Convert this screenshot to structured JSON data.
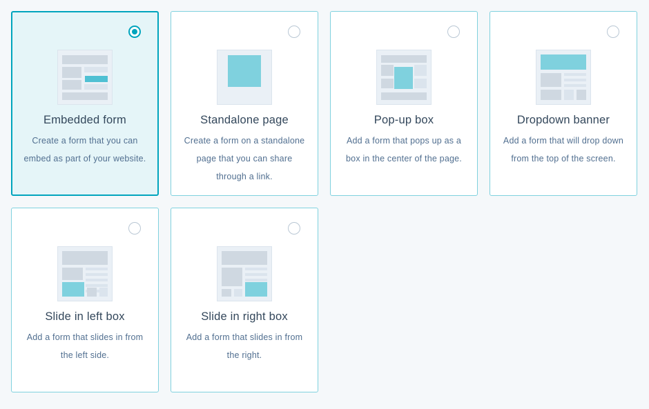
{
  "colors": {
    "accent": "#00a4bd",
    "illustration_highlight": "#7fd1de",
    "illustration_frame": "#eaf0f6",
    "selected_background": "#e5f5f8"
  },
  "selected_option": "embedded",
  "options": [
    {
      "id": "embedded",
      "title": "Embedded form",
      "description": "Create a form that you can embed as part of your website.",
      "selected": true,
      "icon": "embedded-form-icon"
    },
    {
      "id": "standalone",
      "title": "Standalone page",
      "description": "Create a form on a standalone page that you can share through a link.",
      "selected": false,
      "icon": "standalone-page-icon"
    },
    {
      "id": "popup",
      "title": "Pop-up box",
      "description": "Add a form that pops up as a box in the center of the page.",
      "selected": false,
      "icon": "popup-box-icon"
    },
    {
      "id": "dropdown",
      "title": "Dropdown banner",
      "description": "Add a form that will drop down from the top of the screen.",
      "selected": false,
      "icon": "dropdown-banner-icon"
    },
    {
      "id": "slide-left",
      "title": "Slide in left box",
      "description": "Add a form that slides in from the left side.",
      "selected": false,
      "icon": "slide-in-left-icon"
    },
    {
      "id": "slide-right",
      "title": "Slide in right box",
      "description": "Add a form that slides in from the right.",
      "selected": false,
      "icon": "slide-in-right-icon"
    }
  ]
}
